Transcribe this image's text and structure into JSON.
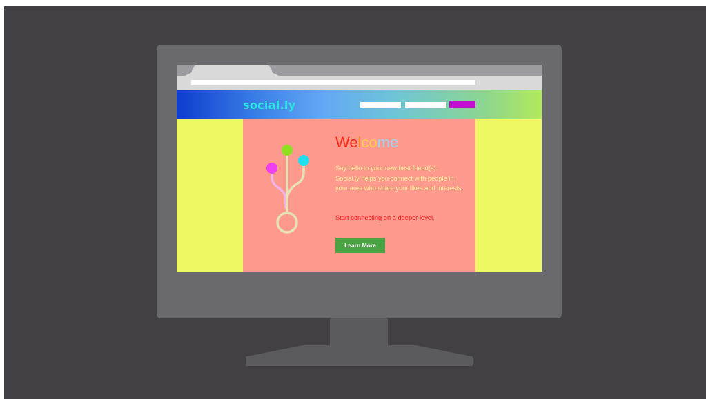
{
  "colors": {
    "backdrop": "#424045",
    "monitor_frame": "#6a696e",
    "stand": "#5b5a5f",
    "side_panels": "#eef862",
    "content_panel": "#fd998d",
    "logo": "#2ee6e0",
    "nav_cta": "#c011cf",
    "button": "#4aa343",
    "intro_text": "#fff29a",
    "tagline_text": "#f01a1a"
  },
  "site": {
    "logo": "social.ly",
    "nav": [
      "nav-link",
      "nav-link",
      "nav-cta-button"
    ]
  },
  "hero": {
    "headline_parts": [
      "We",
      "l",
      "co",
      "me"
    ],
    "intro": "Say hello to your new best friend(s). Social.ly helps you connect with people in your area who share your likes and interests.",
    "tagline": "Start connecting on a deeper level.",
    "button_label": "Learn More"
  },
  "graphic": {
    "icon": "usb-connection-icon",
    "node_colors": [
      "#ef3ff0",
      "#8fe020",
      "#1ee0f2"
    ],
    "stem_color": "#e8e1b3",
    "branch_color": "#f2b3e8"
  }
}
